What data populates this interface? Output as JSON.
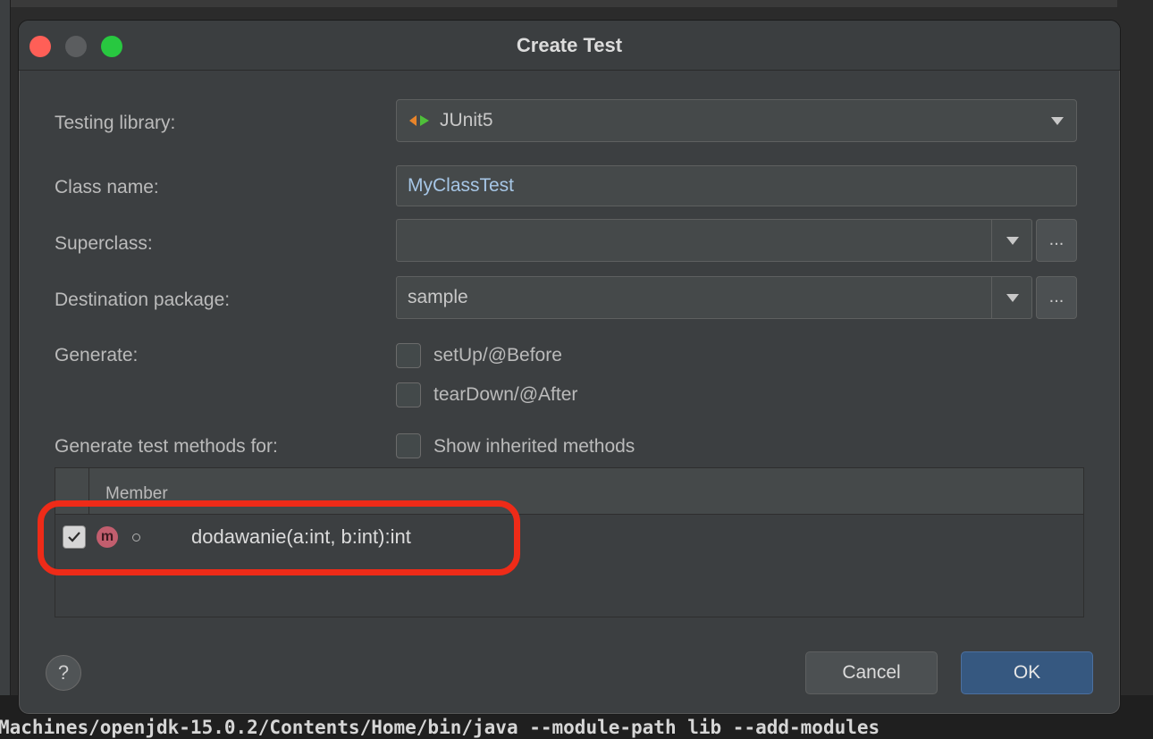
{
  "dialog": {
    "title": "Create Test"
  },
  "form": {
    "testing_library_label": "Testing library:",
    "testing_library_value": "JUnit5",
    "class_name_label": "Class name:",
    "class_name_value": "MyClassTest",
    "superclass_label": "Superclass:",
    "superclass_value": "",
    "destination_package_label": "Destination package:",
    "destination_package_value": "sample",
    "browse_label": "...",
    "generate_label": "Generate:",
    "setup_label": "setUp/@Before",
    "teardown_label": "tearDown/@After",
    "generate_methods_label": "Generate test methods for:",
    "show_inherited_label": "Show inherited methods"
  },
  "table": {
    "header_member": "Member",
    "rows": [
      {
        "checked": true,
        "icon": "m",
        "name": "dodawanie(a:int, b:int):int"
      }
    ]
  },
  "buttons": {
    "help": "?",
    "cancel": "Cancel",
    "ok": "OK"
  },
  "background": {
    "terminal_text": "Machines/openjdk-15.0.2/Contents/Home/bin/java --module-path lib --add-modules"
  },
  "colors": {
    "accent_ok": "#365880",
    "highlight": "#ee2b18"
  }
}
